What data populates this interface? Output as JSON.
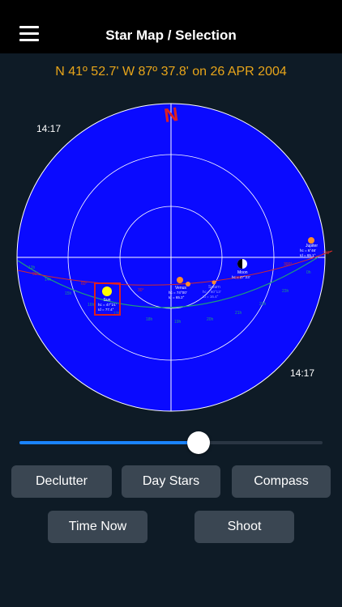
{
  "header": {
    "title": "Star Map / Selection",
    "menu_icon": "hamburger-menu-icon"
  },
  "position_line": "N 41º 52.7' W 87º 37.8' on 26 APR 2004",
  "map": {
    "north_label": "N",
    "time_top_left": "14:17",
    "time_bottom_right": "14:17",
    "bodies": [
      {
        "name": "Sun",
        "line2": "hc = 47°21'",
        "line3": "Id = 77.4°"
      },
      {
        "name": "Venus",
        "line2": "hc = 74°00'",
        "line3": "Id = 65.2°"
      },
      {
        "name": "Saturn",
        "line2": "hc = 60°13'",
        "line3": "Id = 16.4°"
      },
      {
        "name": "Moon",
        "line2": "hc = 47°23'",
        "line3": ""
      },
      {
        "name": "Jupiter",
        "line2": "hc = 6°46'",
        "line3": "Id = 65.1°"
      }
    ],
    "colors": {
      "sky": "#0a0aff",
      "grid": "#ffffff",
      "ecliptic": "#d42a2a",
      "equator": "#1f9e7a",
      "planet": "#ff8c2a",
      "sun": "#ffff00",
      "north": "#e02020"
    }
  },
  "slider": {
    "value": 0.59
  },
  "buttons": {
    "declutter": "Declutter",
    "day_stars": "Day Stars",
    "compass": "Compass",
    "time_now": "Time Now",
    "shoot": "Shoot"
  },
  "accent_color": "#1a84ff"
}
